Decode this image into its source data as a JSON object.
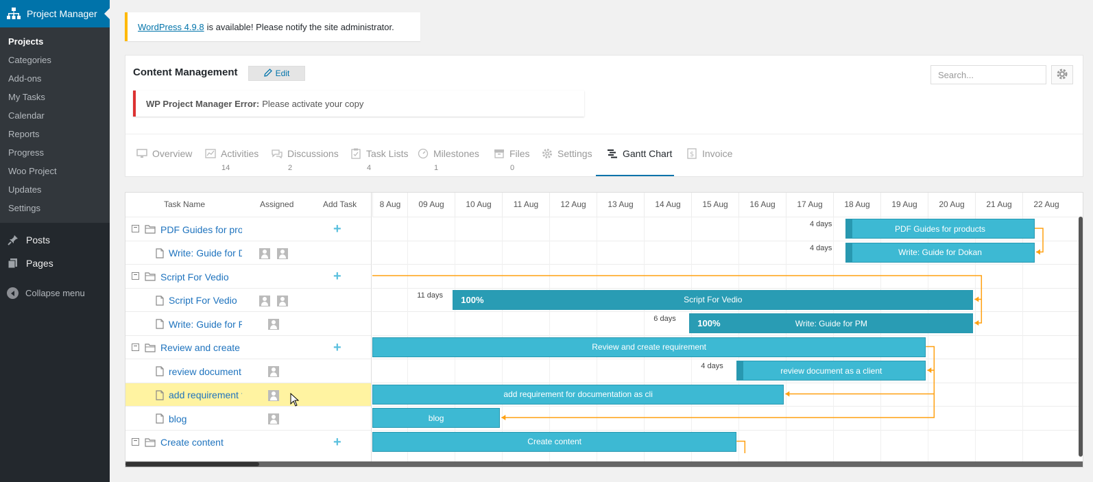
{
  "sidebar": {
    "app_title": "Project Manager",
    "submenu": [
      {
        "label": "Projects",
        "active": true
      },
      {
        "label": "Categories"
      },
      {
        "label": "Add-ons"
      },
      {
        "label": "My Tasks"
      },
      {
        "label": "Calendar"
      },
      {
        "label": "Reports"
      },
      {
        "label": "Progress"
      },
      {
        "label": "Woo Project"
      },
      {
        "label": "Updates"
      },
      {
        "label": "Settings"
      }
    ],
    "posts": "Posts",
    "pages": "Pages",
    "collapse": "Collapse menu"
  },
  "notice": {
    "link": "WordPress 4.9.8",
    "text": "is available! Please notify the site administrator."
  },
  "project": {
    "title": "Content Management",
    "edit_label": "Edit",
    "error_bold": "WP Project Manager Error:",
    "error_text": "Please activate your copy",
    "search_placeholder": "Search..."
  },
  "tabs": [
    {
      "label": "Overview",
      "count": ""
    },
    {
      "label": "Activities",
      "count": "14"
    },
    {
      "label": "Discussions",
      "count": "2"
    },
    {
      "label": "Task Lists",
      "count": "4"
    },
    {
      "label": "Milestones",
      "count": "1"
    },
    {
      "label": "Files",
      "count": "0"
    },
    {
      "label": "Settings",
      "count": ""
    },
    {
      "label": "Gantt Chart",
      "count": ""
    },
    {
      "label": "Invoice",
      "count": ""
    }
  ],
  "gantt": {
    "headers": {
      "task_name": "Task Name",
      "assigned": "Assigned",
      "add_task": "Add Task"
    },
    "dates": [
      "8 Aug",
      "09 Aug",
      "10 Aug",
      "11 Aug",
      "12 Aug",
      "13 Aug",
      "14 Aug",
      "15 Aug",
      "16 Aug",
      "17 Aug",
      "18 Aug",
      "19 Aug",
      "20 Aug",
      "21 Aug",
      "22 Aug"
    ],
    "rows": [
      {
        "name": "PDF Guides for prod",
        "type": "group",
        "avatars": 0
      },
      {
        "name": "Write: Guide for Do",
        "type": "task",
        "avatars": 2
      },
      {
        "name": "Script For Vedio",
        "type": "group",
        "avatars": 0
      },
      {
        "name": "Script For Vedio",
        "type": "task",
        "avatars": 2
      },
      {
        "name": "Write: Guide for PM",
        "type": "task",
        "avatars": 1
      },
      {
        "name": "Review and create re",
        "type": "group",
        "avatars": 0
      },
      {
        "name": "review document a",
        "type": "task",
        "avatars": 1
      },
      {
        "name": "add requirement fo",
        "type": "task",
        "avatars": 1,
        "highlight": true
      },
      {
        "name": "blog",
        "type": "task",
        "avatars": 1
      },
      {
        "name": "Create content",
        "type": "group",
        "avatars": 0
      }
    ],
    "bars": [
      {
        "row": 0,
        "start": 10,
        "end": 14,
        "label": "PDF Guides for products",
        "duration": "4 days",
        "progress": 0
      },
      {
        "row": 1,
        "start": 10,
        "end": 14,
        "label": "Write: Guide for Dokan",
        "duration": "4 days",
        "progress": 0
      },
      {
        "row": 3,
        "start": 1.7,
        "end": 12.7,
        "label": "Script For Vedio",
        "duration": "11 days",
        "progress": 100,
        "pct": "100%"
      },
      {
        "row": 4,
        "start": 6.7,
        "end": 12.7,
        "label": "Write: Guide for PM",
        "duration": "6 days",
        "progress": 100,
        "pct": "100%"
      },
      {
        "row": 5,
        "start": 0,
        "end": 11.7,
        "label": "Review and create requirement",
        "duration": "",
        "progress": 0
      },
      {
        "row": 6,
        "start": 7.7,
        "end": 11.7,
        "label": "review document as a client",
        "duration": "4 days",
        "progress": 0
      },
      {
        "row": 7,
        "start": 0,
        "end": 8.7,
        "label": "add requirement for documentation as cli",
        "duration": "",
        "progress": 0
      },
      {
        "row": 8,
        "start": 0,
        "end": 2.7,
        "label": "blog",
        "duration": "",
        "progress": 0
      },
      {
        "row": 9,
        "start": 0,
        "end": 7.7,
        "label": "Create content",
        "duration": "",
        "progress": 0
      }
    ]
  }
}
